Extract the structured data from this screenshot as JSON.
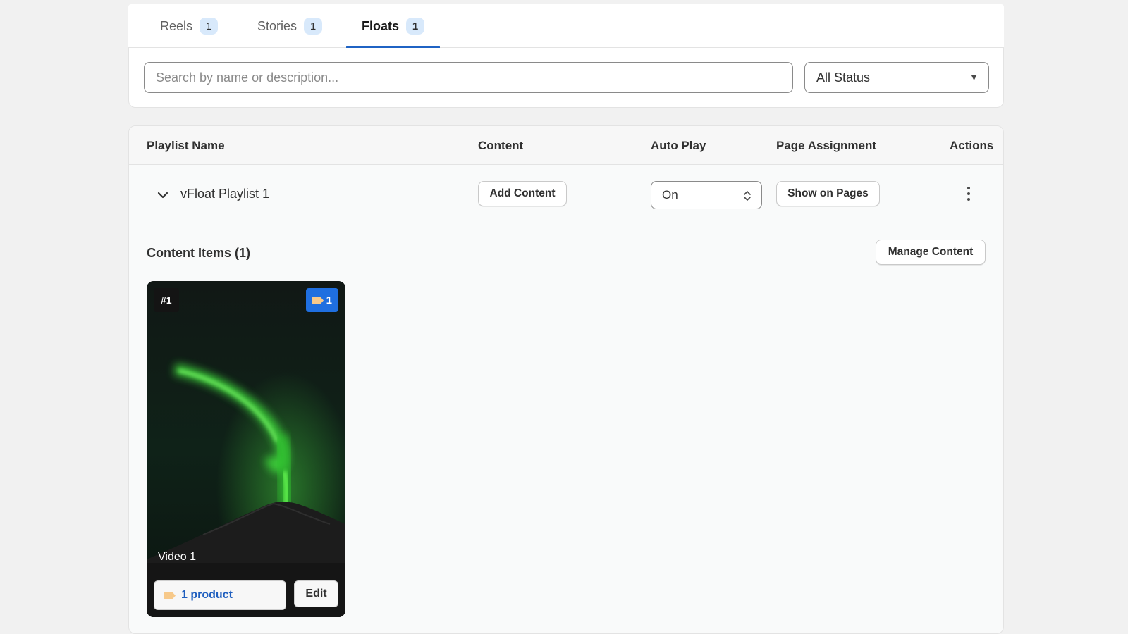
{
  "tabs": [
    {
      "label": "Reels",
      "count": "1"
    },
    {
      "label": "Stories",
      "count": "1"
    },
    {
      "label": "Floats",
      "count": "1"
    }
  ],
  "active_tab": "Floats",
  "filters": {
    "search_placeholder": "Search by name or description...",
    "status_value": "All Status"
  },
  "table": {
    "headers": {
      "playlist_name": "Playlist Name",
      "content": "Content",
      "auto_play": "Auto Play",
      "page_assignment": "Page Assignment",
      "actions": "Actions"
    },
    "row": {
      "name": "vFloat Playlist 1",
      "add_content_label": "Add Content",
      "auto_play_value": "On",
      "show_on_pages_label": "Show on Pages"
    }
  },
  "content_items": {
    "title": "Content Items (1)",
    "manage_label": "Manage Content",
    "items": [
      {
        "position": "#1",
        "product_count": "1",
        "title": "Video 1",
        "products_label": "1 product",
        "edit_label": "Edit"
      }
    ]
  },
  "icons": {
    "expand": "chevron-down-icon",
    "actions": "more-vertical-icon",
    "select": "select-arrows-icon",
    "product": "tag-icon"
  },
  "colors": {
    "accent": "#1f63c4",
    "badge_bg": "#d8e9fb",
    "product_badge": "#1f6fe0",
    "link": "#1f5fbf"
  }
}
